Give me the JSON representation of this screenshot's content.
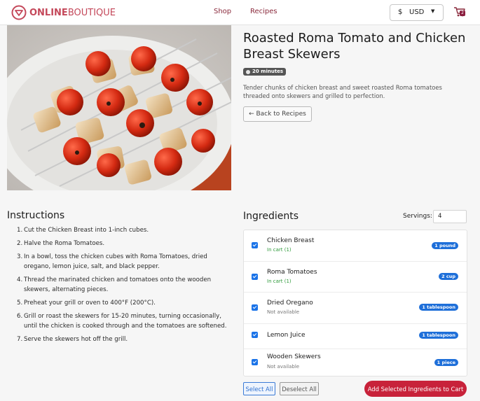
{
  "header": {
    "logo_bold": "ONLINE",
    "logo_light": "BOUTIQUE",
    "nav": [
      {
        "label": "Shop"
      },
      {
        "label": "Recipes"
      }
    ],
    "currency": {
      "symbol": "$",
      "code": "USD"
    },
    "cart_count": "2"
  },
  "recipe": {
    "title": "Roasted Roma Tomato and Chicken Breast Skewers",
    "time": "20 minutes",
    "description": "Tender chunks of chicken breast and sweet roasted Roma tomatoes threaded onto skewers and grilled to perfection.",
    "back_label": "← Back to Recipes"
  },
  "instructions": {
    "title": "Instructions",
    "steps": [
      {
        "num": "1.",
        "text": "Cut the Chicken Breast into 1-inch cubes."
      },
      {
        "num": "2.",
        "text": "Halve the Roma Tomatoes."
      },
      {
        "num": "3.",
        "text": "In a bowl, toss the chicken cubes with Roma Tomatoes, dried oregano, lemon juice, salt, and black pepper."
      },
      {
        "num": "4.",
        "text": "Thread the marinated chicken and tomatoes onto the wooden skewers, alternating pieces."
      },
      {
        "num": "5.",
        "text": "Preheat your grill or oven to 400°F (200°C)."
      },
      {
        "num": "6.",
        "text": "Grill or roast the skewers for 15-20 minutes, turning occasionally, until the chicken is cooked through and the tomatoes are softened."
      },
      {
        "num": "7.",
        "text": "Serve the skewers hot off the grill."
      }
    ]
  },
  "ingredients": {
    "title": "Ingredients",
    "servings_label": "Servings:",
    "servings_value": "4",
    "items": [
      {
        "name": "Chicken Breast",
        "status": "In cart (1)",
        "qty": "1 pound",
        "checked": true
      },
      {
        "name": "Roma Tomatoes",
        "status": "In cart (1)",
        "qty": "2 cup",
        "checked": true
      },
      {
        "name": "Dried Oregano",
        "status": "Not available",
        "qty": "1 tablespoon",
        "checked": true
      },
      {
        "name": "Lemon Juice",
        "status": "",
        "qty": "1 tablespoon",
        "checked": true
      },
      {
        "name": "Wooden Skewers",
        "status": "Not available",
        "qty": "1 piece",
        "checked": true
      }
    ],
    "select_all": "Select All",
    "deselect_all": "Deselect All",
    "add_to_cart": "Add Selected Ingredients to Cart"
  },
  "colors": {
    "brand": "#c4485a",
    "accent_red": "#c8223a",
    "accent_blue": "#1e6fd9",
    "in_cart_green": "#2e9a3a"
  }
}
